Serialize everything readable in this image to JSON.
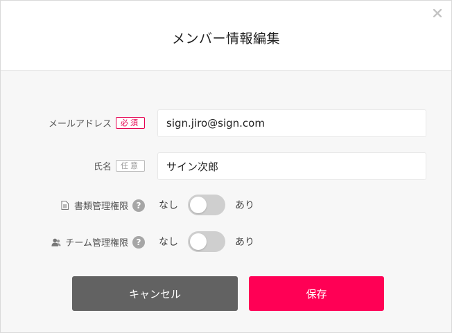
{
  "dialog": {
    "title": "メンバー情報編集",
    "close_icon": "close-icon"
  },
  "form": {
    "email": {
      "label": "メールアドレス",
      "badge": "必須",
      "value": "sign.jiro@sign.com"
    },
    "name": {
      "label": "氏名",
      "badge": "任意",
      "value": "サイン次郎"
    },
    "document_permission": {
      "label": "書類管理権限",
      "icon": "document-icon",
      "help": "?",
      "off_label": "なし",
      "on_label": "あり",
      "enabled": false
    },
    "team_permission": {
      "label": "チーム管理権限",
      "icon": "user-icon",
      "help": "?",
      "off_label": "なし",
      "on_label": "あり",
      "enabled": false
    }
  },
  "actions": {
    "cancel_label": "キャンセル",
    "save_label": "保存"
  },
  "colors": {
    "accent": "#ff0055",
    "cancel": "#626262",
    "required_badge": "#e5004f"
  }
}
